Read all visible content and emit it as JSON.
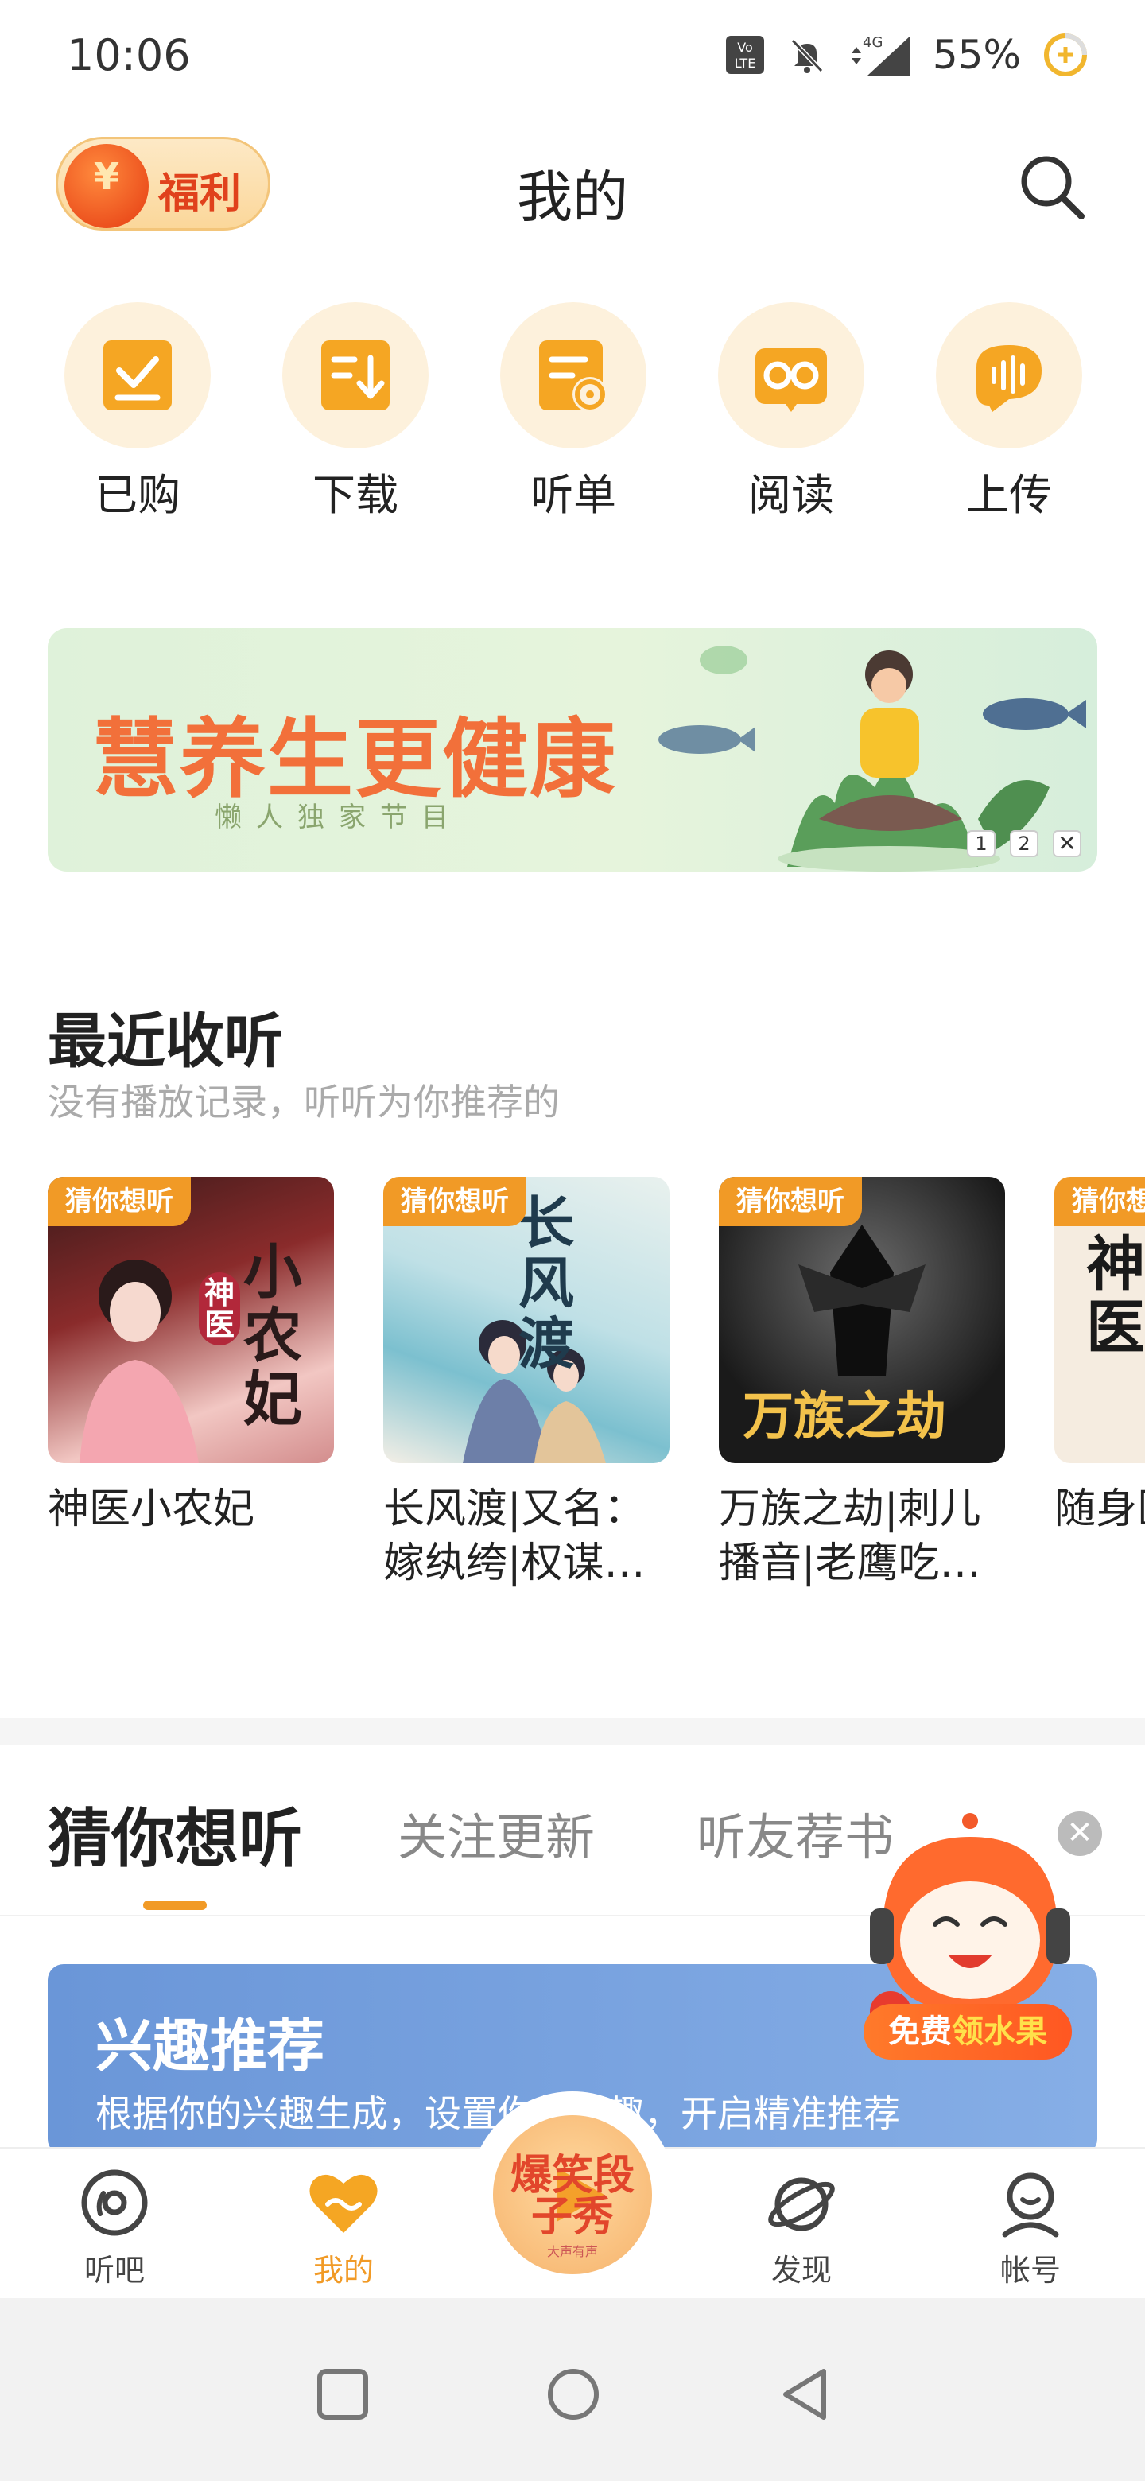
{
  "status_bar": {
    "time": "10:06",
    "battery": "55%",
    "network": "4G",
    "icons": [
      "volte-icon",
      "mute-icon",
      "signal-icon",
      "battery-icon"
    ]
  },
  "header": {
    "welfare_label": "福利",
    "welfare_coin": "¥",
    "title": "我的"
  },
  "quick_actions": [
    {
      "label": "已购",
      "icon": "purchased-icon"
    },
    {
      "label": "下载",
      "icon": "download-icon"
    },
    {
      "label": "听单",
      "icon": "playlist-icon"
    },
    {
      "label": "阅读",
      "icon": "reading-icon"
    },
    {
      "label": "上传",
      "icon": "upload-icon"
    }
  ],
  "banner": {
    "title": "慧养生更健康",
    "subtitle": "懒人独家节目",
    "pages": [
      "1",
      "2"
    ],
    "close": "✕"
  },
  "recent": {
    "title": "最近收听",
    "subtitle": "没有播放记录，听听为你推荐的",
    "tag": "猜你想听",
    "items": [
      {
        "title": "神医小农妃",
        "cover_text": "小农妃",
        "cover_badge": "神医"
      },
      {
        "title": "长风渡|又名：嫁纨绔|权谋…",
        "cover_text": "长风渡"
      },
      {
        "title": "万族之劫|刺儿播音|老鹰吃…",
        "cover_text": "万族之劫"
      },
      {
        "title": "随身医小…",
        "cover_text": "神医"
      }
    ]
  },
  "tabs": {
    "items": [
      "猜你想听",
      "关注更新",
      "听友荐书"
    ],
    "active": 0
  },
  "interest": {
    "title": "兴趣推荐",
    "desc": "根据你的兴趣生成，设置你的兴趣，开启精准推荐"
  },
  "mascot": {
    "btn_prefix": "免费",
    "btn_highlight": "领水果",
    "close": "✕"
  },
  "bottom_nav": {
    "items": [
      {
        "label": "听吧",
        "icon": "disc-icon"
      },
      {
        "label": "我的",
        "icon": "heart-icon"
      },
      {
        "label": "发现",
        "icon": "planet-icon"
      },
      {
        "label": "帐号",
        "icon": "account-icon"
      }
    ],
    "center_text": "爆笑段子秀",
    "center_small": "大声有声",
    "active": 1
  },
  "colors": {
    "accent": "#f19a26",
    "title_text": "#222222",
    "sub_text": "#aaaaaa"
  }
}
